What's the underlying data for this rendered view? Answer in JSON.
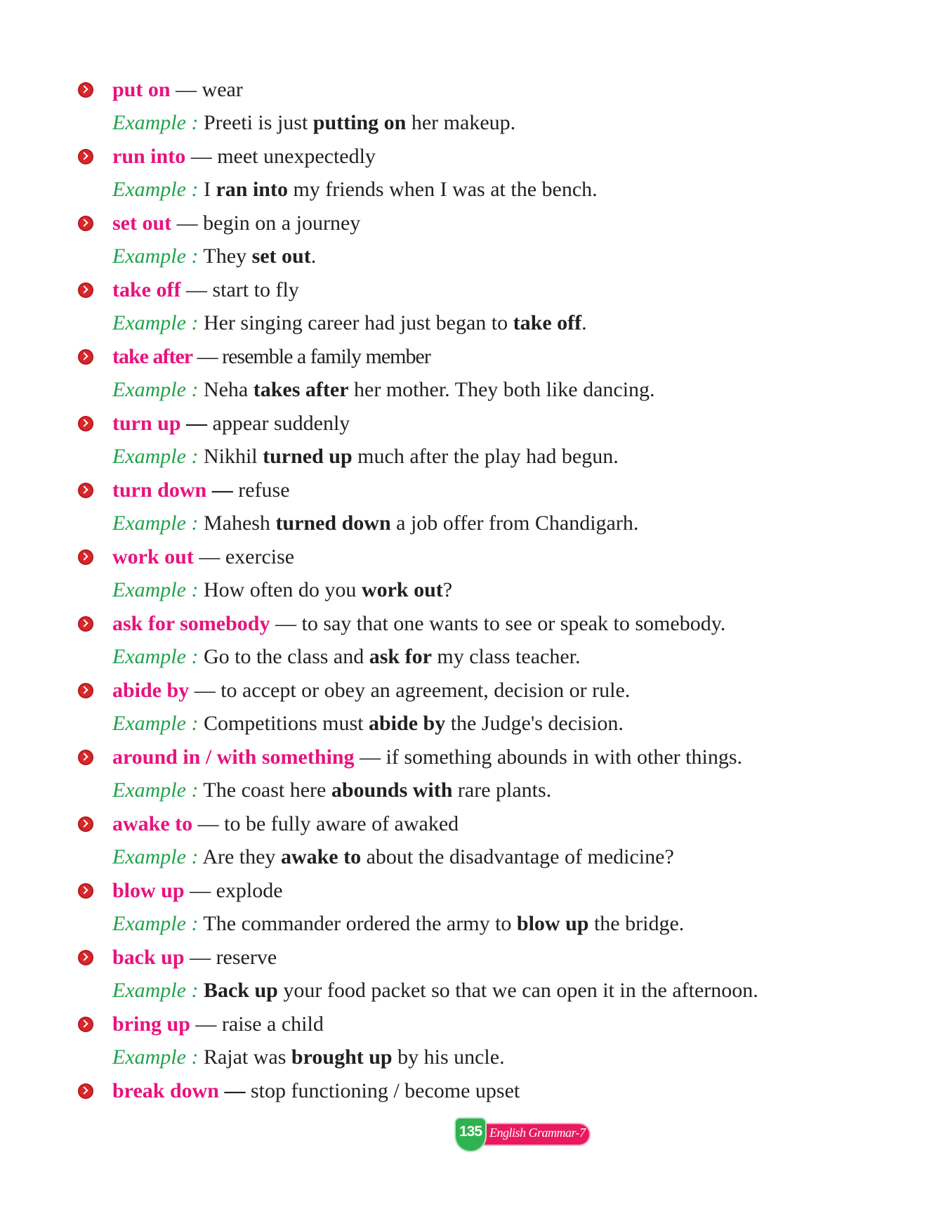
{
  "entries": [
    {
      "term": "put on",
      "dash": "—",
      "meaning": "wear",
      "example_label": "Example :",
      "ex_pre": "Preeti is just",
      "ex_bold": "putting on",
      "ex_post": "her makeup."
    },
    {
      "term": "run into",
      "dash": "—",
      "meaning": "meet unexpectedly",
      "example_label": "Example :",
      "ex_pre": "I",
      "ex_bold": "ran into",
      "ex_post": "my friends when I was at the bench."
    },
    {
      "term": "set out",
      "dash": "—",
      "meaning": "begin on a journey",
      "example_label": "Example :",
      "ex_pre": "They",
      "ex_bold": "set out",
      "ex_post": "."
    },
    {
      "term": "take off",
      "dash": "—",
      "meaning": "start to fly",
      "example_label": "Example :",
      "ex_pre": "Her singing career had just began to",
      "ex_bold": "take off",
      "ex_post": "."
    },
    {
      "term": "take after",
      "dash": "—",
      "meaning": "resemble a family member",
      "example_label": "Example :",
      "ex_pre": "Neha",
      "ex_bold": "takes after",
      "ex_post": "her mother. They both like dancing."
    },
    {
      "term": "turn up",
      "dash": "—",
      "meaning": "appear suddenly",
      "example_label": "Example :",
      "ex_pre": "Nikhil",
      "ex_bold": "turned up",
      "ex_post": "much after the play had begun."
    },
    {
      "term": "turn down",
      "dash": "—",
      "meaning": "refuse",
      "example_label": "Example :",
      "ex_pre": "Mahesh",
      "ex_bold": "turned down",
      "ex_post": "a job offer from Chandigarh."
    },
    {
      "term": "work out",
      "dash": "—",
      "meaning": "exercise",
      "example_label": "Example :",
      "ex_pre": "How often do you",
      "ex_bold": "work out",
      "ex_post": "?"
    },
    {
      "term": "ask for somebody",
      "dash": "—",
      "meaning": "to say that one wants to see or speak to somebody.",
      "example_label": "Example :",
      "ex_pre": "Go to the class and",
      "ex_bold": "ask for",
      "ex_post": "my class teacher."
    },
    {
      "term": "abide by",
      "dash": "—",
      "meaning": "to accept or obey an agreement, decision or rule.",
      "example_label": "Example :",
      "ex_pre": "Competitions must",
      "ex_bold": "abide by",
      "ex_post": "the Judge's decision."
    },
    {
      "term": "around in / with something",
      "dash": "—",
      "meaning": "if something abounds in with other things.",
      "example_label": "Example :",
      "ex_pre": "The coast here",
      "ex_bold": "abounds with",
      "ex_post": "rare plants."
    },
    {
      "term": "awake to",
      "dash": "—",
      "meaning": "to be fully aware of awaked",
      "example_label": "Example :",
      "ex_pre": "Are they",
      "ex_bold": "awake to",
      "ex_post": "about the disadvantage of medicine?"
    },
    {
      "term": "blow up",
      "dash": "—",
      "meaning": "explode",
      "example_label": "Example :",
      "ex_pre": "The commander ordered the army to",
      "ex_bold": "blow up",
      "ex_post": "the bridge."
    },
    {
      "term": "back up",
      "dash": "—",
      "meaning": "reserve",
      "example_label": "Example :",
      "ex_pre": "",
      "ex_bold": "Back up",
      "ex_post": " your food packet so that we can open it in the afternoon."
    },
    {
      "term": "bring up",
      "dash": "—",
      "meaning": "raise a child",
      "example_label": "Example :",
      "ex_pre": "Rajat was",
      "ex_bold": "brought up",
      "ex_post": "by his uncle."
    },
    {
      "term": "break down",
      "dash": "—",
      "meaning": "stop functioning / become upset"
    }
  ],
  "footer": {
    "page_number": "135",
    "book_title": "English Grammar-7"
  },
  "colors": {
    "term": "#e8127f",
    "example_label": "#1ea34a",
    "bullet": "#d8262a",
    "footer_pill": "#e8195d",
    "footer_shield": "#2fb24f"
  }
}
